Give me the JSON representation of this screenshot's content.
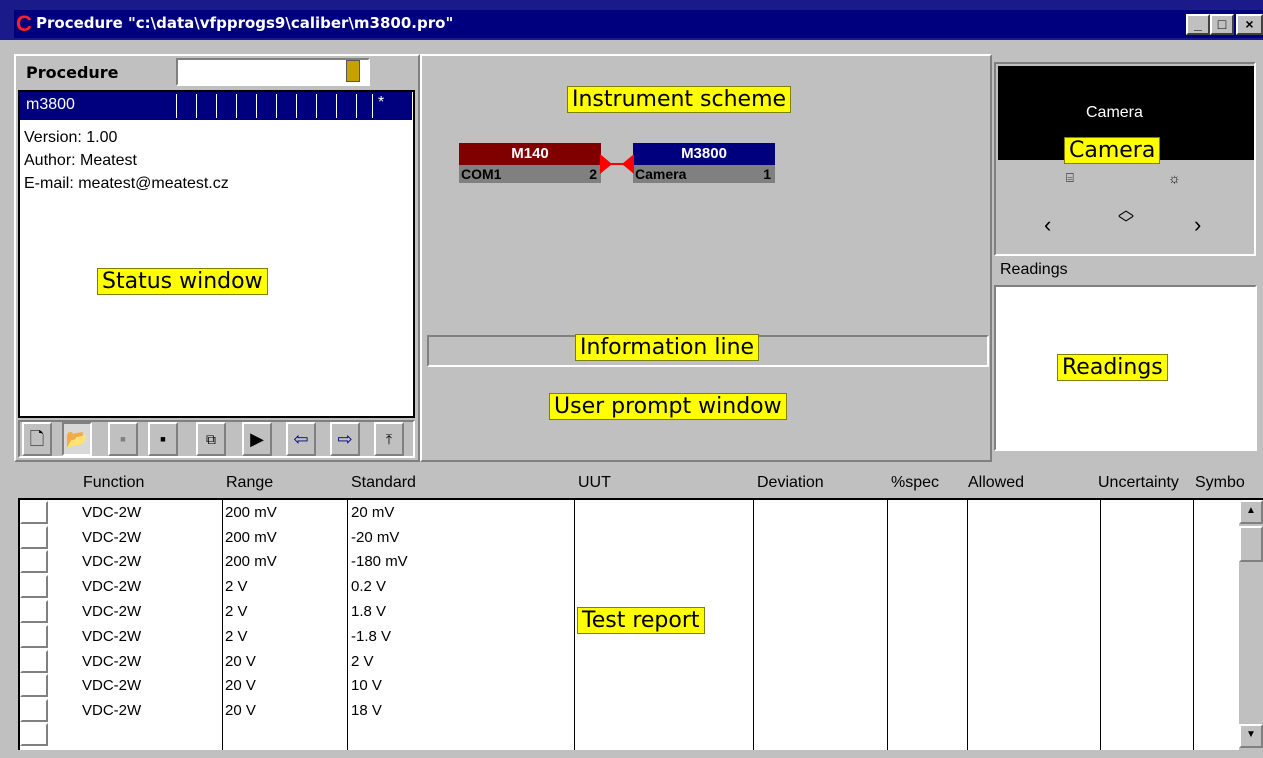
{
  "window": {
    "title": "Procedure \"c:\\data\\vfpprogs9\\caliber\\m3800.pro\"",
    "logo": "C",
    "buttons": [
      "_",
      "□",
      "×"
    ]
  },
  "procedure_label": "Procedure",
  "procedure_row": {
    "name": "m3800",
    "marker": "*"
  },
  "status_lines": [
    "Version: 1.00",
    "Author:  Meatest",
    "E-mail: meatest@meatest.cz"
  ],
  "callouts": {
    "status": "Status window",
    "instrument": "Instrument scheme",
    "camera": "Camera",
    "info": "Information line",
    "prompt": "User prompt window",
    "readings": "Readings",
    "report": "Test report"
  },
  "instruments": [
    {
      "name": "M140",
      "port": "COM1",
      "num": "2",
      "color": "#800000"
    },
    {
      "name": "M3800",
      "port": "Camera",
      "num": "1",
      "color": "#00007f"
    }
  ],
  "camera_text": "Camera",
  "readings_label": "Readings",
  "toolbar": [
    "new-file-icon",
    "open-folder-icon",
    "save-disabled-icon",
    "save-as-icon",
    "copy-icon",
    "play-icon",
    "import-icon",
    "export-icon",
    "folder-up-icon"
  ],
  "table": {
    "headers": [
      "Function",
      "Range",
      "Standard",
      "UUT",
      "Deviation",
      "%spec",
      "Allowed",
      "Uncertainty",
      "Symbo"
    ],
    "rows": [
      [
        "VDC-2W",
        "200 mV",
        "20 mV"
      ],
      [
        "VDC-2W",
        "200 mV",
        "-20 mV"
      ],
      [
        "VDC-2W",
        "200 mV",
        "-180 mV"
      ],
      [
        "VDC-2W",
        "2 V",
        "0.2 V"
      ],
      [
        "VDC-2W",
        "2 V",
        "1.8 V"
      ],
      [
        "VDC-2W",
        "2 V",
        "-1.8 V"
      ],
      [
        "VDC-2W",
        "20 V",
        "2 V"
      ],
      [
        "VDC-2W",
        "20 V",
        "10 V"
      ],
      [
        "VDC-2W",
        "20 V",
        "18 V"
      ]
    ]
  }
}
